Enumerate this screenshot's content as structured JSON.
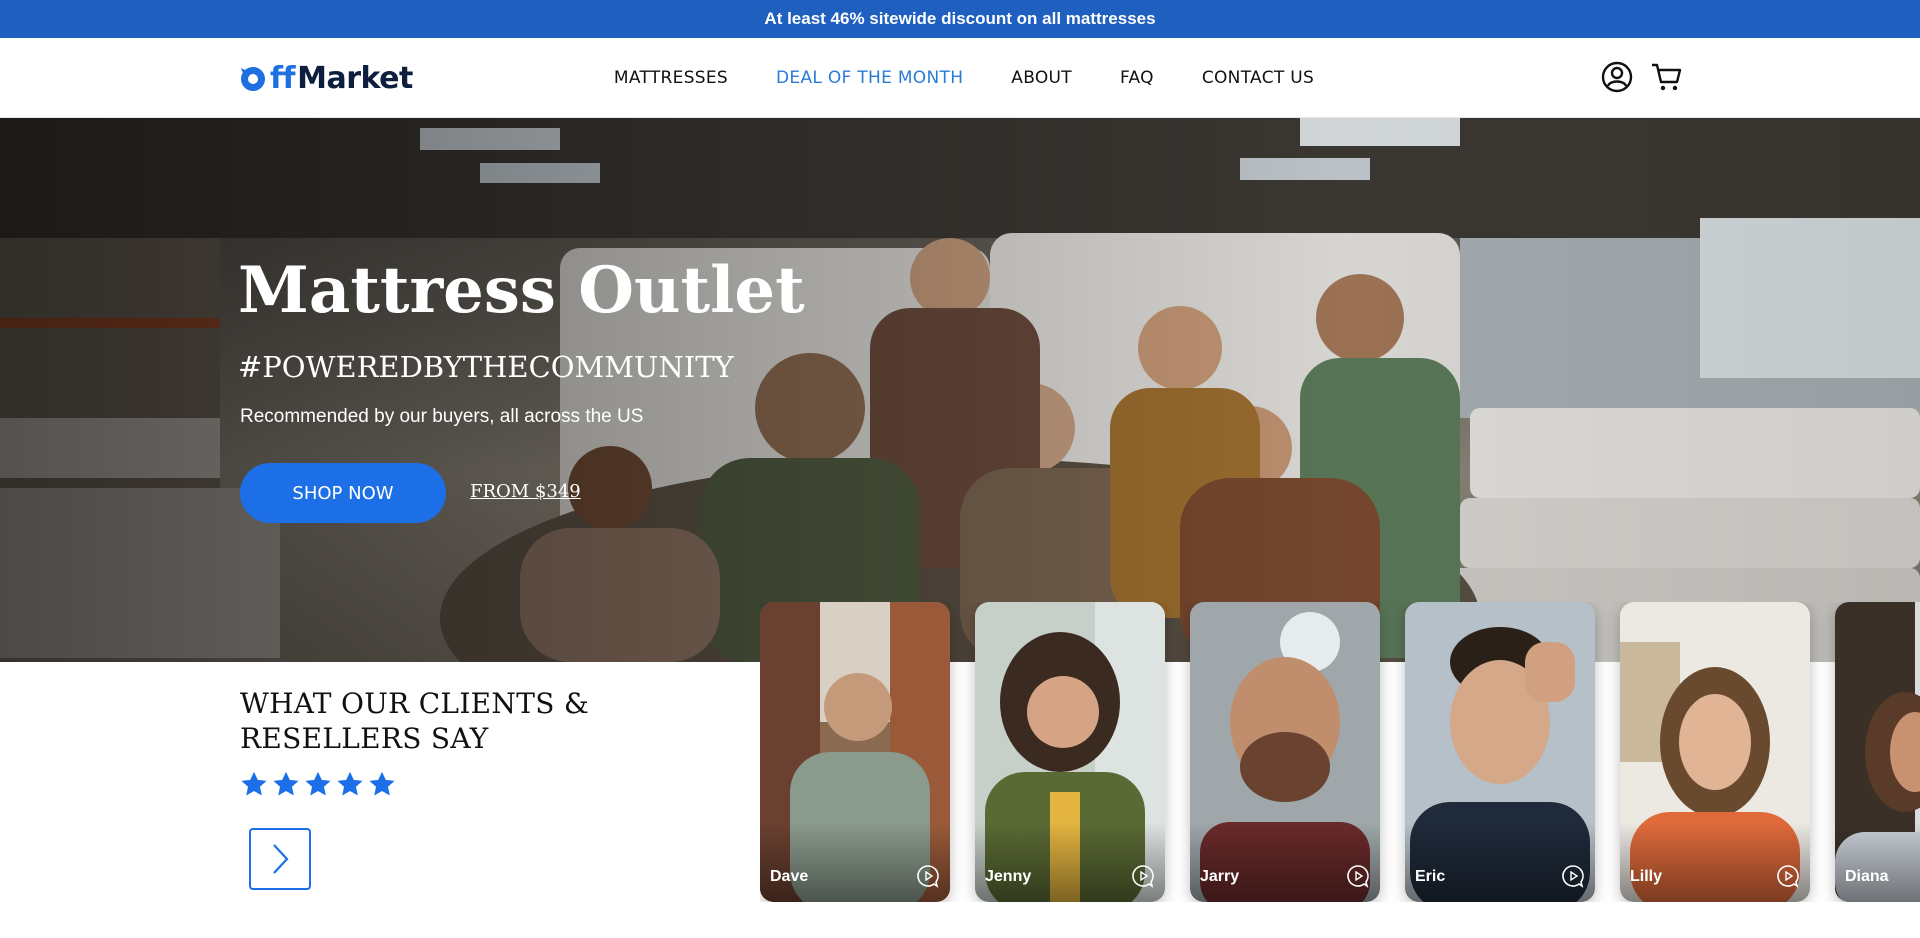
{
  "announcement": {
    "text": "At least  46% sitewide discount on all mattresses"
  },
  "header": {
    "logo": {
      "part1": "ff",
      "part2": "Market"
    },
    "nav": [
      {
        "label": "MATTRESSES",
        "active": false
      },
      {
        "label": "DEAL OF THE MONTH",
        "active": true
      },
      {
        "label": "ABOUT",
        "active": false
      },
      {
        "label": "FAQ",
        "active": false
      },
      {
        "label": "CONTACT US",
        "active": false
      }
    ],
    "icons": [
      "user-icon",
      "cart-icon"
    ]
  },
  "hero": {
    "title": "Mattress Outlet",
    "tagline": "#POWEREDBYTHECOMMUNITY",
    "subtitle": "Recommended by our buyers, all across the US",
    "shop_button": "SHOP NOW",
    "price_link": "FROM $349"
  },
  "testimonials": {
    "heading_line1": "WHAT OUR CLIENTS &",
    "heading_line2": "RESELLERS SAY",
    "rating": 5,
    "rating_max": 5,
    "clients": [
      {
        "name": "Dave"
      },
      {
        "name": "Jenny"
      },
      {
        "name": "Jarry"
      },
      {
        "name": "Eric"
      },
      {
        "name": "Lilly"
      },
      {
        "name": "Diana"
      }
    ]
  },
  "colors": {
    "announce_bg": "#1f5fbf",
    "accent": "#1c6fe6",
    "nav_active": "#2b7bd6",
    "logo_dark": "#0d1f3c"
  }
}
